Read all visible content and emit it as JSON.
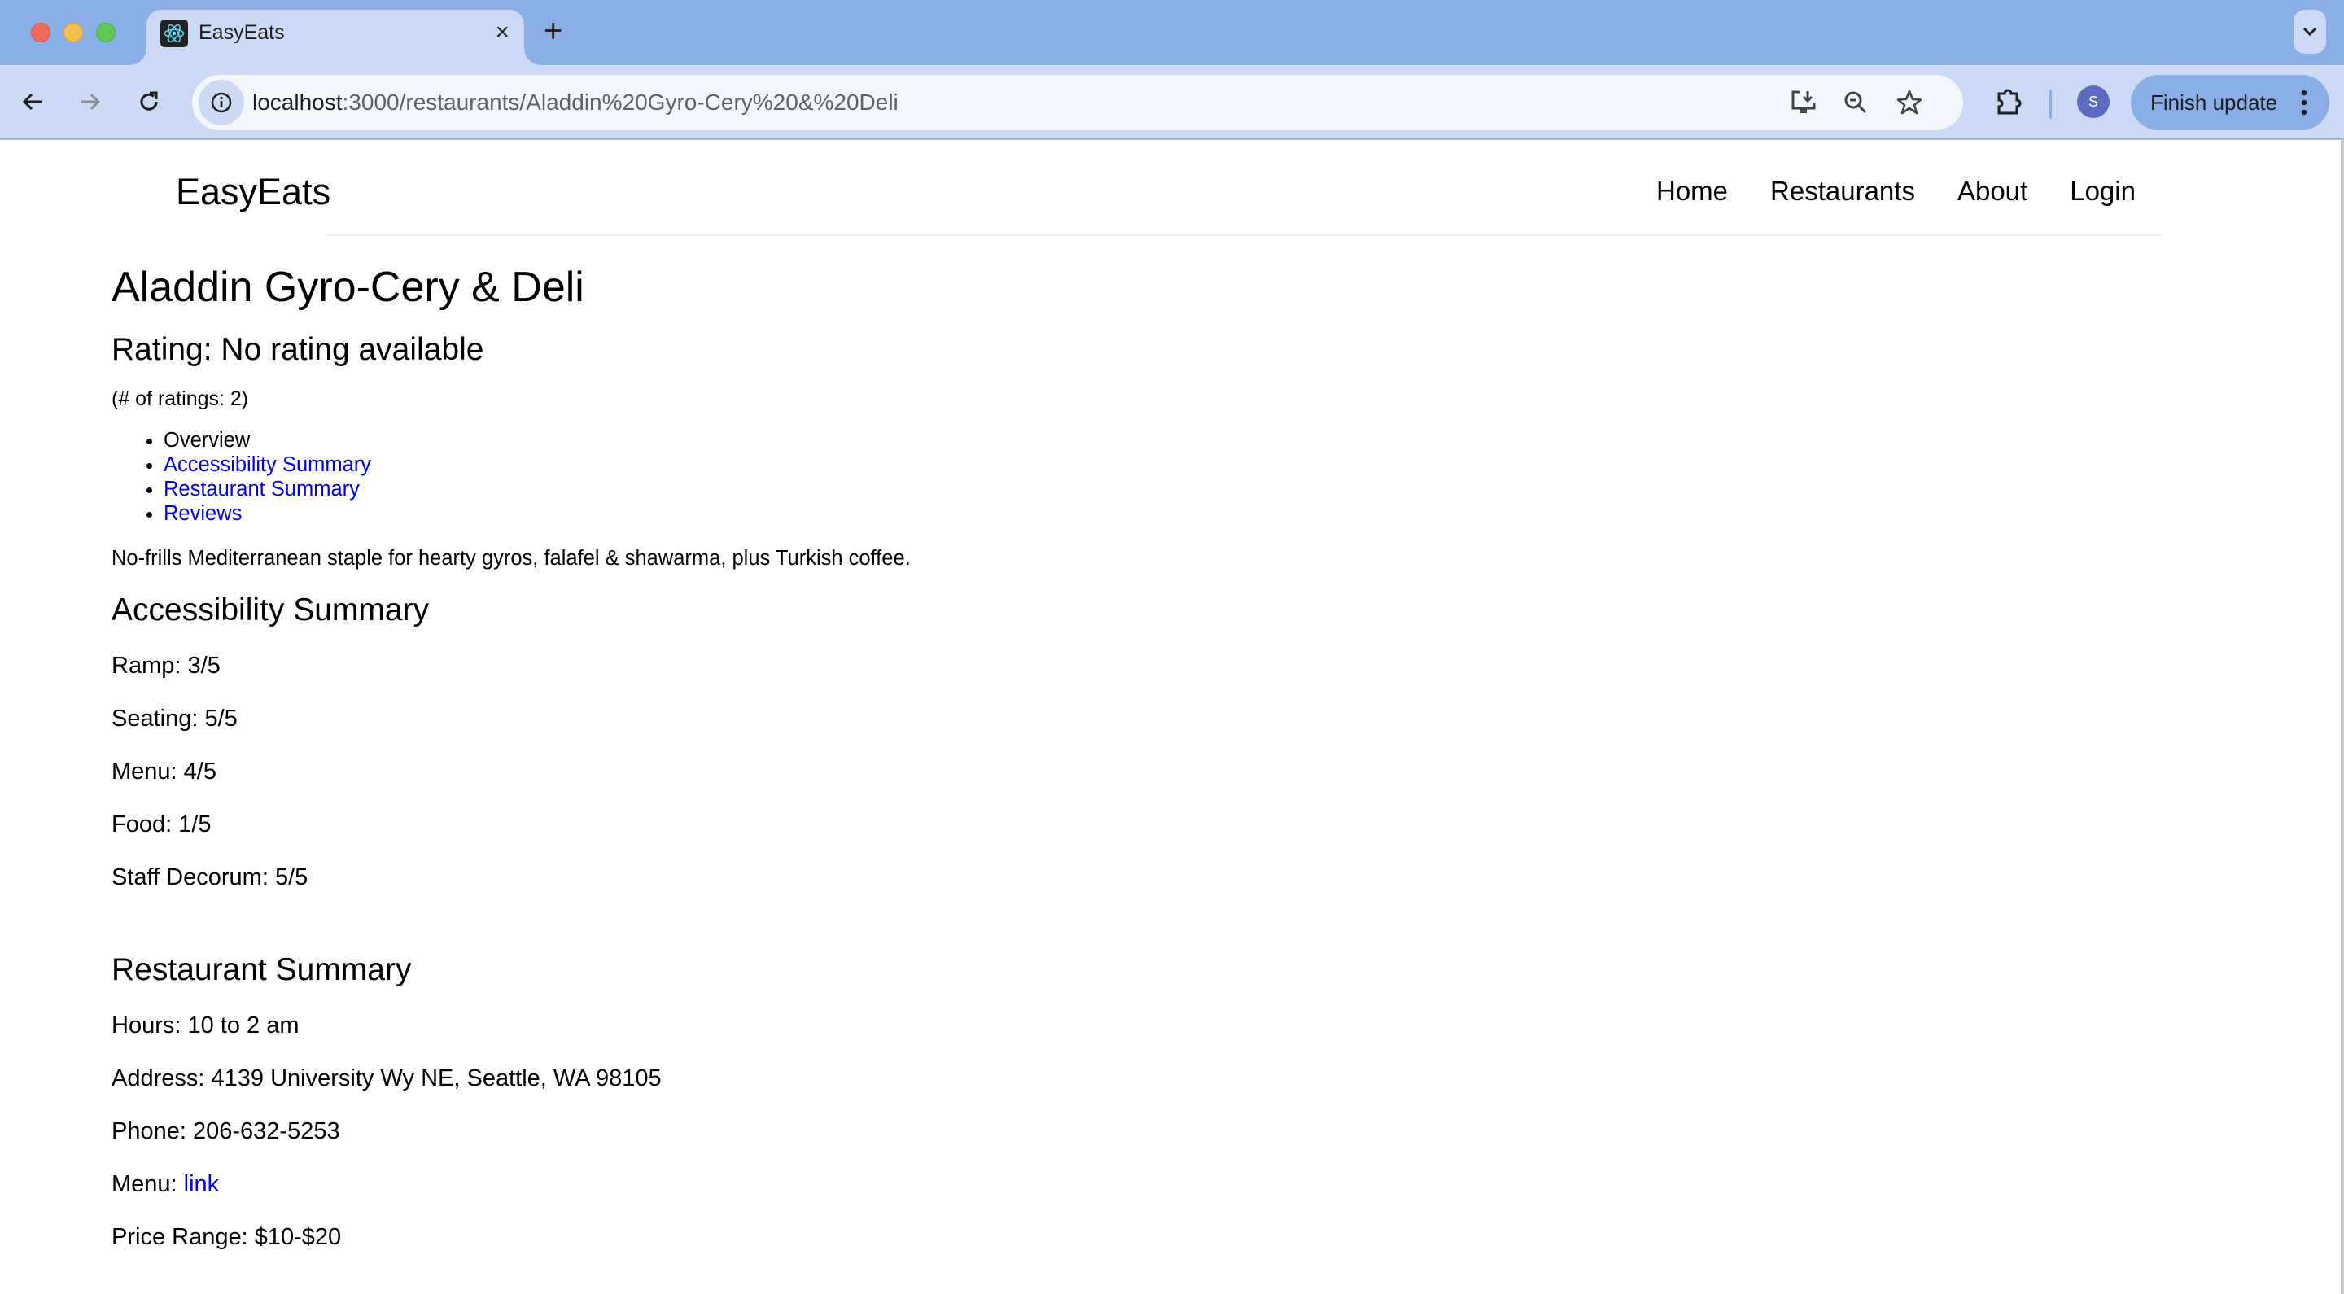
{
  "browser": {
    "tab_title": "EasyEats",
    "tab_close": "×",
    "new_tab": "+",
    "url_host": "localhost",
    "url_rest": ":3000/restaurants/Aladdin%20Gyro-Cery%20&%20Deli",
    "avatar_initial": "S",
    "finish_update_label": "Finish update",
    "icons": {
      "back": "arrow-left-icon",
      "forward": "arrow-right-icon",
      "reload": "reload-icon",
      "site_info": "info-icon",
      "install": "install-app-icon",
      "zoom": "zoom-out-icon",
      "bookmark": "star-icon",
      "extensions": "puzzle-icon",
      "menu": "kebab-icon",
      "tab_list": "chevron-down-icon"
    }
  },
  "header": {
    "brand": "EasyEats",
    "nav": [
      {
        "label": "Home"
      },
      {
        "label": "Restaurants"
      },
      {
        "label": "About"
      },
      {
        "label": "Login"
      }
    ]
  },
  "restaurant": {
    "name": "Aladdin Gyro-Cery & Deli",
    "rating_text": "Rating: No rating available",
    "ratings_count_text": "(# of ratings: 2)",
    "toc": [
      {
        "label": "Overview",
        "link": false
      },
      {
        "label": "Accessibility Summary",
        "link": true
      },
      {
        "label": "Restaurant Summary",
        "link": true
      },
      {
        "label": "Reviews",
        "link": true
      }
    ],
    "description": "No-frills Mediterranean staple for hearty gyros, falafel & shawarma, plus Turkish coffee."
  },
  "accessibility": {
    "heading": "Accessibility Summary",
    "items": [
      {
        "label": "Ramp",
        "score": "3/5"
      },
      {
        "label": "Seating",
        "score": "5/5"
      },
      {
        "label": "Menu",
        "score": "4/5"
      },
      {
        "label": "Food",
        "score": "1/5"
      },
      {
        "label": "Staff Decorum",
        "score": "5/5"
      }
    ]
  },
  "summary": {
    "heading": "Restaurant Summary",
    "hours_label": "Hours:",
    "hours": "10 to 2 am",
    "address_label": "Address:",
    "address": "4139 University Wy NE, Seattle, WA 98105",
    "phone_label": "Phone:",
    "phone": "206-632-5253",
    "menu_label": "Menu:",
    "menu_link": "link",
    "price_label": "Price Range:",
    "price": "$10-$20"
  },
  "colors": {
    "link": "#0000ee",
    "tabstrip": "#8aaee6",
    "toolbar": "#ccdaf5"
  }
}
